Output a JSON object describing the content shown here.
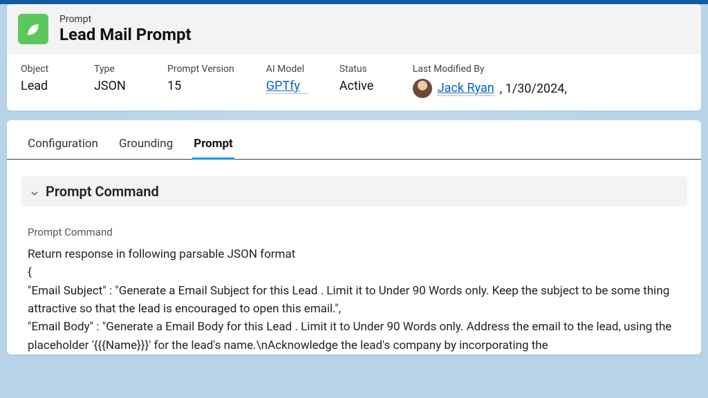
{
  "header": {
    "eyebrow": "Prompt",
    "title": "Lead Mail Prompt"
  },
  "meta": {
    "object": {
      "label": "Object",
      "value": "Lead"
    },
    "type": {
      "label": "Type",
      "value": "JSON"
    },
    "version": {
      "label": "Prompt Version",
      "value": "15"
    },
    "model": {
      "label": "AI Model",
      "value": "GPTfy"
    },
    "status": {
      "label": "Status",
      "value": "Active"
    },
    "modified": {
      "label": "Last Modified By",
      "user": "Jack Ryan",
      "date": ", 1/30/2024,"
    }
  },
  "tabs": {
    "config": "Configuration",
    "grounding": "Grounding",
    "prompt": "Prompt"
  },
  "section": {
    "title": "Prompt Command",
    "field_label": "Prompt Command",
    "body": "Return response in following parsable JSON format\n{\n\"Email Subject\" : \"Generate a Email Subject for this Lead . Limit it to Under 90 Words only. Keep the subject to be some thing attractive so that the lead is encouraged to open this email.\",\n\"Email Body\" : \"Generate a Email Body for this Lead . Limit it to Under 90 Words only. Address the email to the lead, using the placeholder '{{{Name}}}' for the lead's name.\\nAcknowledge the lead's company by incorporating the"
  }
}
